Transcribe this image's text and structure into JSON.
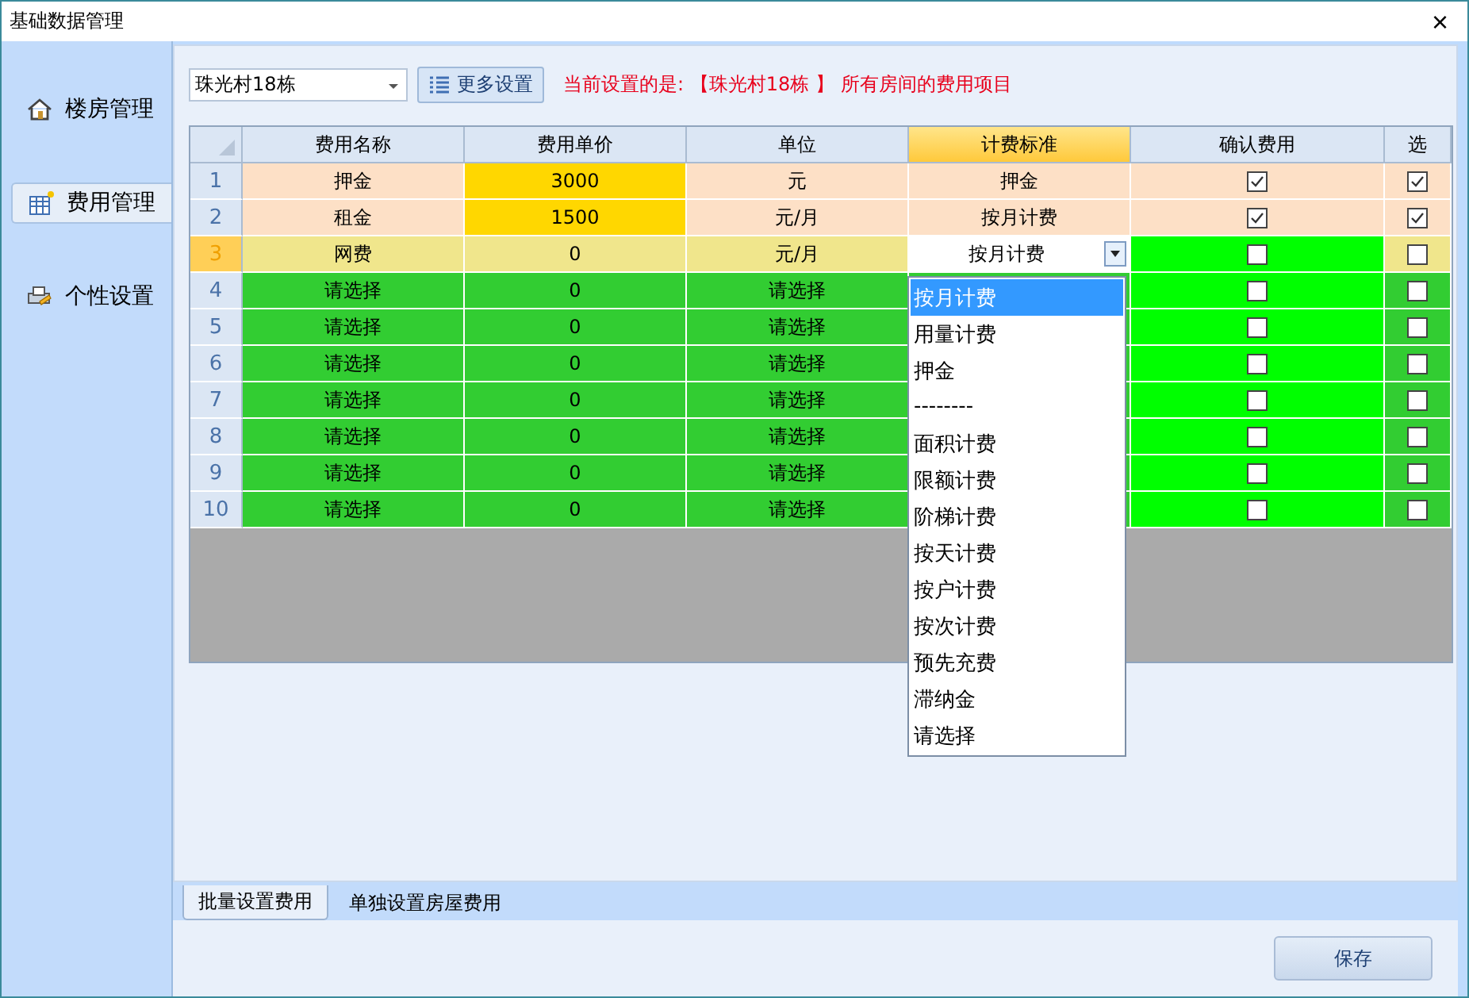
{
  "window": {
    "title": "基础数据管理",
    "close": "×"
  },
  "sidebar": {
    "items": [
      {
        "label": "楼房管理",
        "kind": "home",
        "selected": false
      },
      {
        "label": "费用管理",
        "kind": "table",
        "selected": true
      },
      {
        "label": "个性设置",
        "kind": "printer",
        "selected": false
      }
    ]
  },
  "toolbar": {
    "building": "珠光村18栋",
    "more_button": "更多设置",
    "notice": "当前设置的是: 【珠光村18栋 】 所有房间的费用项目"
  },
  "table": {
    "columns": [
      {
        "label": "费用名称",
        "selected": false
      },
      {
        "label": "费用单价",
        "selected": false
      },
      {
        "label": "单位",
        "selected": false
      },
      {
        "label": "计费标准",
        "selected": true
      },
      {
        "label": "确认费用",
        "selected": false
      },
      {
        "label": "选",
        "selected": false
      }
    ],
    "rows": [
      {
        "index": "1",
        "kind": "fixed",
        "name": "押金",
        "price": "3000",
        "unit": "元",
        "standard": "押金",
        "confirmed": true,
        "chosen": true,
        "selected": false
      },
      {
        "index": "2",
        "kind": "fixed",
        "name": "租金",
        "price": "1500",
        "unit": "元/月",
        "standard": "按月计费",
        "confirmed": true,
        "chosen": true,
        "selected": false
      },
      {
        "index": "3",
        "kind": "current",
        "name": "网费",
        "price": "0",
        "unit": "元/月",
        "standard": "按月计费",
        "confirmed": false,
        "chosen": false,
        "selected": true
      },
      {
        "index": "4",
        "kind": "empty",
        "name": "请选择",
        "price": "0",
        "unit": "请选择",
        "confirmed": false,
        "chosen": false,
        "selected": false
      },
      {
        "index": "5",
        "kind": "empty",
        "name": "请选择",
        "price": "0",
        "unit": "请选择",
        "confirmed": false,
        "chosen": false,
        "selected": false
      },
      {
        "index": "6",
        "kind": "empty",
        "name": "请选择",
        "price": "0",
        "unit": "请选择",
        "confirmed": false,
        "chosen": false,
        "selected": false
      },
      {
        "index": "7",
        "kind": "empty",
        "name": "请选择",
        "price": "0",
        "unit": "请选择",
        "confirmed": false,
        "chosen": false,
        "selected": false
      },
      {
        "index": "8",
        "kind": "empty",
        "name": "请选择",
        "price": "0",
        "unit": "请选择",
        "confirmed": false,
        "chosen": false,
        "selected": false
      },
      {
        "index": "9",
        "kind": "empty",
        "name": "请选择",
        "price": "0",
        "unit": "请选择",
        "confirmed": false,
        "chosen": false,
        "selected": false
      },
      {
        "index": "10",
        "kind": "empty",
        "name": "请选择",
        "price": "0",
        "unit": "请选择",
        "confirmed": false,
        "chosen": false,
        "selected": false
      }
    ]
  },
  "dropdown": {
    "options": [
      {
        "label": "按月计费",
        "selected": true
      },
      {
        "label": "用量计费",
        "selected": false
      },
      {
        "label": "押金",
        "selected": false
      },
      {
        "label": "--------",
        "selected": false
      },
      {
        "label": "面积计费",
        "selected": false
      },
      {
        "label": "限额计费",
        "selected": false
      },
      {
        "label": "阶梯计费",
        "selected": false
      },
      {
        "label": "按天计费",
        "selected": false
      },
      {
        "label": "按户计费",
        "selected": false
      },
      {
        "label": "按次计费",
        "selected": false
      },
      {
        "label": "预先充费",
        "selected": false
      },
      {
        "label": "滞纳金",
        "selected": false
      },
      {
        "label": "请选择",
        "selected": false
      }
    ]
  },
  "bottom_tabs": [
    {
      "label": "批量设置费用",
      "selected": true
    },
    {
      "label": "单独设置房屋费用",
      "selected": false
    }
  ],
  "save_button": "保存"
}
